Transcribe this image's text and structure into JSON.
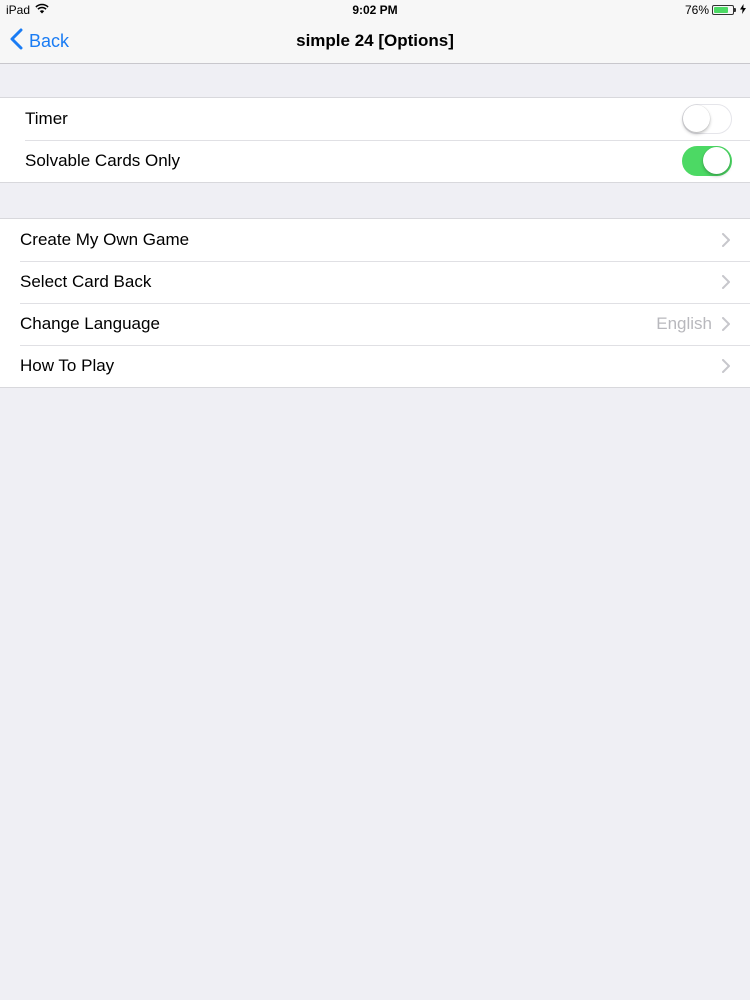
{
  "status_bar": {
    "device": "iPad",
    "time": "9:02 PM",
    "battery_percent": "76%",
    "battery_level": 0.76,
    "icons": [
      "wifi-icon",
      "battery-icon",
      "charging-bolt-icon"
    ]
  },
  "nav": {
    "back_label": "Back",
    "title": "simple 24 [Options]"
  },
  "toggles": [
    {
      "label": "Timer",
      "on": false
    },
    {
      "label": "Solvable Cards Only",
      "on": true
    }
  ],
  "menu": [
    {
      "label": "Create My Own Game",
      "detail": ""
    },
    {
      "label": "Select Card Back",
      "detail": ""
    },
    {
      "label": "Change Language",
      "detail": "English"
    },
    {
      "label": "How To Play",
      "detail": ""
    }
  ],
  "colors": {
    "accent": "#1a7cf4",
    "toggle_on": "#4cd964",
    "background": "#efeff4"
  }
}
